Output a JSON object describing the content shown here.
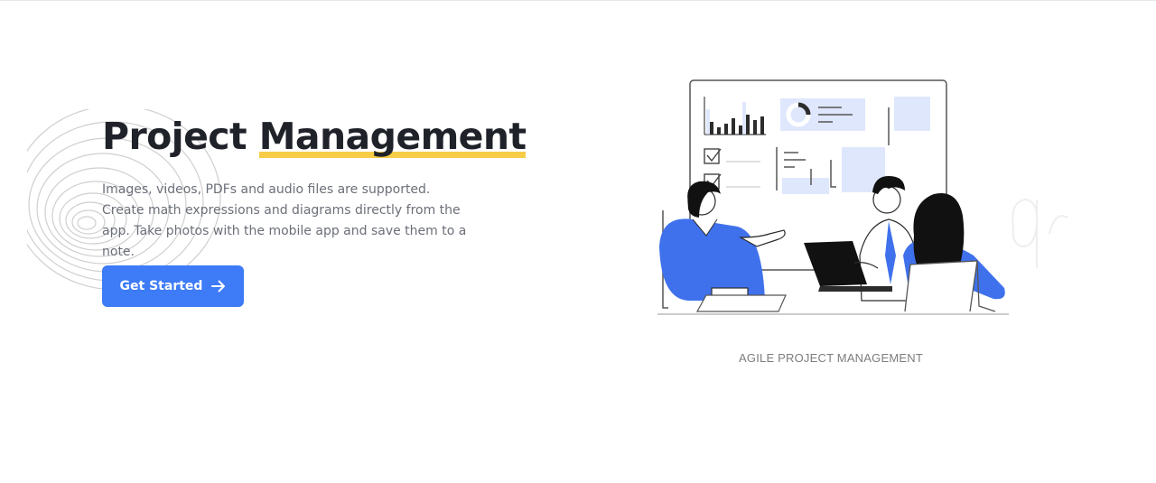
{
  "hero": {
    "title_part1": "Project ",
    "title_highlight": "Management",
    "description": "Images, videos, PDFs and audio files are supported. Create math expressions and diagrams directly from the app. Take photos with the mobile app and save them to a note.",
    "cta_label": "Get Started",
    "cta_icon": "arrow-right-icon"
  },
  "illustration": {
    "caption": "AGILE PROJECT MANAGEMENT"
  },
  "colors": {
    "accent": "#3d7bf7",
    "highlight": "#f7cc47",
    "title": "#1f2229",
    "body_text": "#6b6f78"
  }
}
